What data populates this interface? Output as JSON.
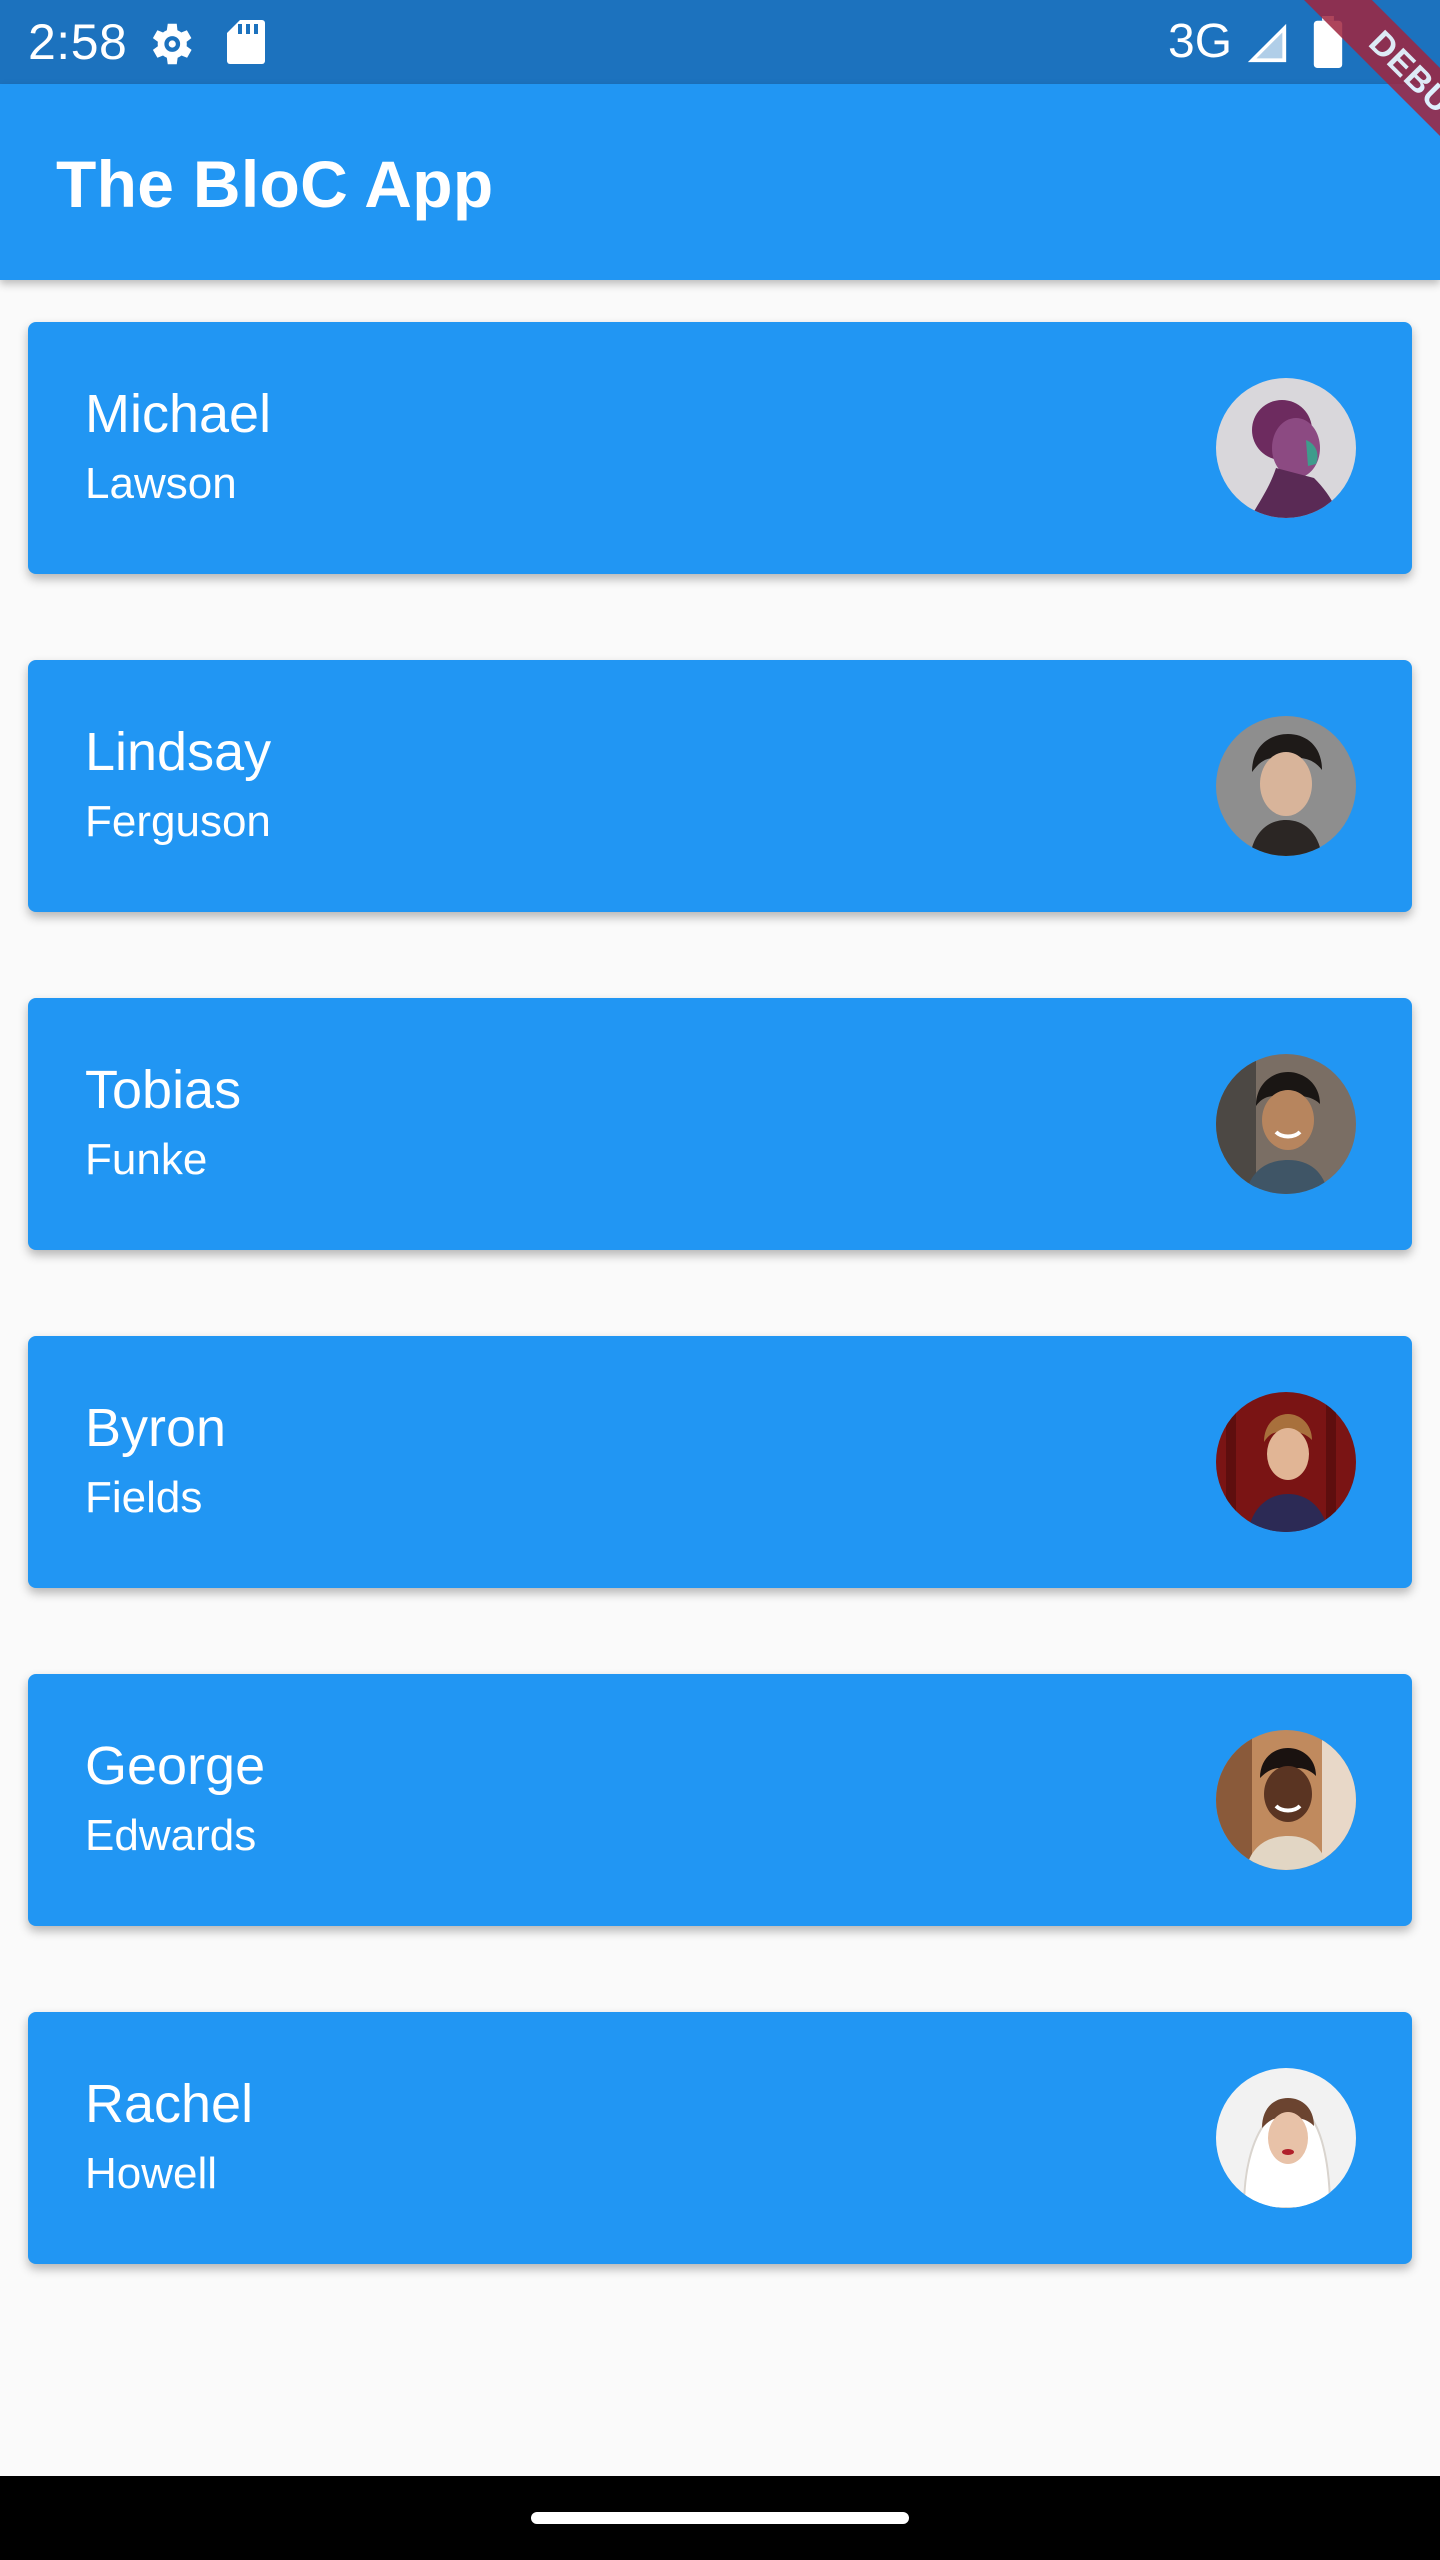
{
  "status_bar": {
    "time": "2:58",
    "network": "3G",
    "icons": [
      "gear-icon",
      "sd-card-icon",
      "signal-icon",
      "battery-icon"
    ]
  },
  "debug_banner": {
    "label": "DEBUG"
  },
  "app_bar": {
    "title": "The BloC App",
    "color": "#2196F3"
  },
  "users": [
    {
      "first_name": "Michael",
      "last_name": "Lawson"
    },
    {
      "first_name": "Lindsay",
      "last_name": "Ferguson"
    },
    {
      "first_name": "Tobias",
      "last_name": "Funke"
    },
    {
      "first_name": "Byron",
      "last_name": "Fields"
    },
    {
      "first_name": "George",
      "last_name": "Edwards"
    },
    {
      "first_name": "Rachel",
      "last_name": "Howell"
    }
  ],
  "colors": {
    "status_bar": "#1C72BE",
    "card": "#2196F3",
    "background": "#FAFAFA",
    "debug_ribbon": "#A0253F"
  }
}
